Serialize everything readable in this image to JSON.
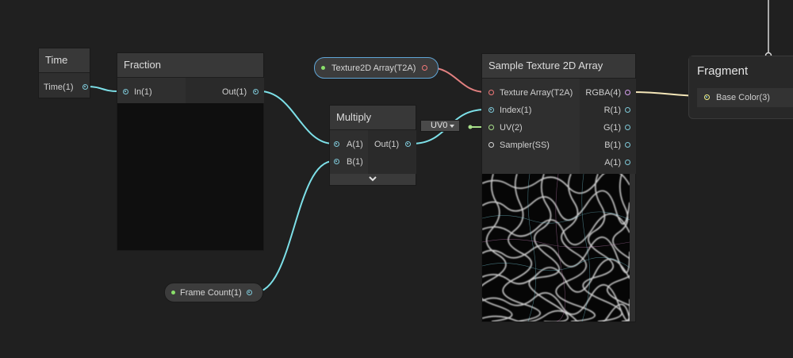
{
  "nodes": {
    "time": {
      "title": "Time",
      "outputs": [
        "Time(1)"
      ]
    },
    "fraction": {
      "title": "Fraction",
      "inputs": [
        "In(1)"
      ],
      "outputs": [
        "Out(1)"
      ]
    },
    "multiply": {
      "title": "Multiply",
      "inputs": [
        "A(1)",
        "B(1)"
      ],
      "outputs": [
        "Out(1)"
      ]
    },
    "sample": {
      "title": "Sample Texture 2D Array",
      "inputs": [
        "Texture Array(T2A)",
        "Index(1)",
        "UV(2)",
        "Sampler(SS)"
      ],
      "outputs": [
        "RGBA(4)",
        "R(1)",
        "G(1)",
        "B(1)",
        "A(1)"
      ]
    },
    "fragment": {
      "title": "Fragment",
      "inputs": [
        "Base Color(3)"
      ]
    }
  },
  "properties": {
    "texture_array": "Texture2D Array(T2A)",
    "frame_count": "Frame Count(1)"
  },
  "uv_dropdown": {
    "value": "UV0"
  },
  "colors": {
    "vector1_port": "#7ec8d8",
    "vector4_port": "#d5a0f0",
    "vector3_port": "#f0f08a",
    "texture_port": "#f07878",
    "uv_port": "#a8e08a",
    "wire_vector1": "#7de0e8",
    "wire_texture": "#e28080",
    "wire_color": "#f4e6b8",
    "background": "#202020"
  },
  "icons": {
    "expand": "chevron-down-icon"
  }
}
